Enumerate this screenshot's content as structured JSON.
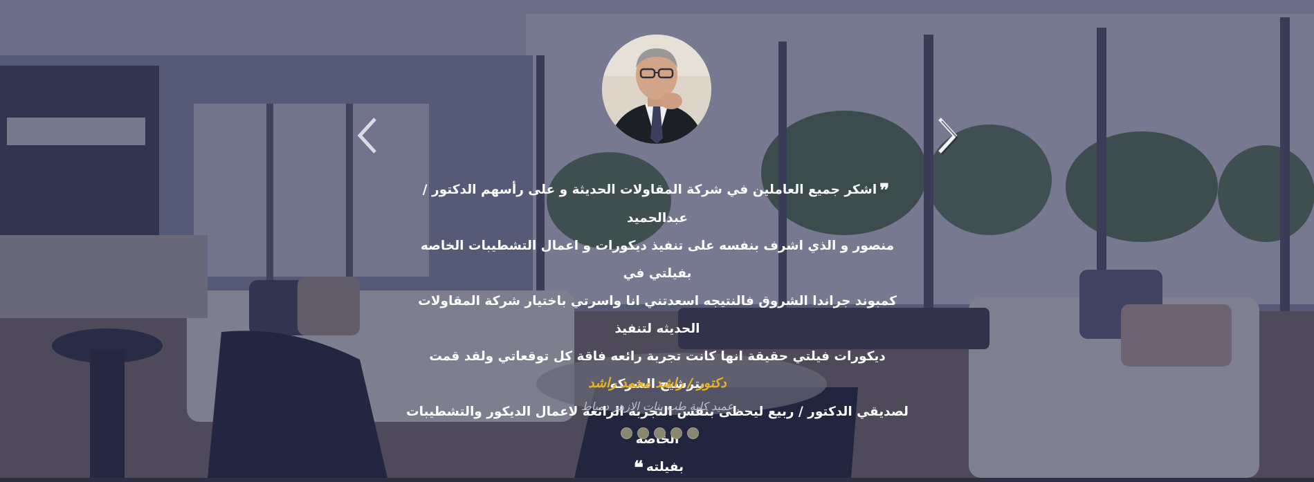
{
  "slider": {
    "prev_icon": "chevron-left-icon",
    "next_icon": "chevron-right-icon",
    "accent_color": "#e8b320",
    "overlay_color": "#282c4e",
    "active_slide": 1,
    "total_slides": 5
  },
  "testimonial": {
    "open_quote": "❞",
    "close_quote": "❝",
    "lines": [
      "اشكر جميع العاملين في شركة المقاولات الحديثة و على رأسهم الدكتور / عبدالحميد",
      "منصور و الذي اشرف بنفسه على تنفيذ ديكورات و اعمال التشطيبات الخاصه بفيلتي في",
      "كمبوند جراندا الشروق فالنتيجه اسعدتني انا واسرتي باختيار شركة المقاولات الحديثه لتنفيذ",
      "ديكورات فيلتي حقيقة انها كانت تجربة رائعه فاقة كل توقعاتي ولقد قمت بترشيح الشركه",
      "لصديقي الدكتور / ربيع ليحظى بنفس التجربه الرائعه لاعمال الديكور والتشطيبات الخاصه",
      "بفيلته"
    ],
    "author_name": "دكتور / راشد محمد راشد",
    "author_title": "عميد كلية طب بنات الازهر دمياط"
  }
}
